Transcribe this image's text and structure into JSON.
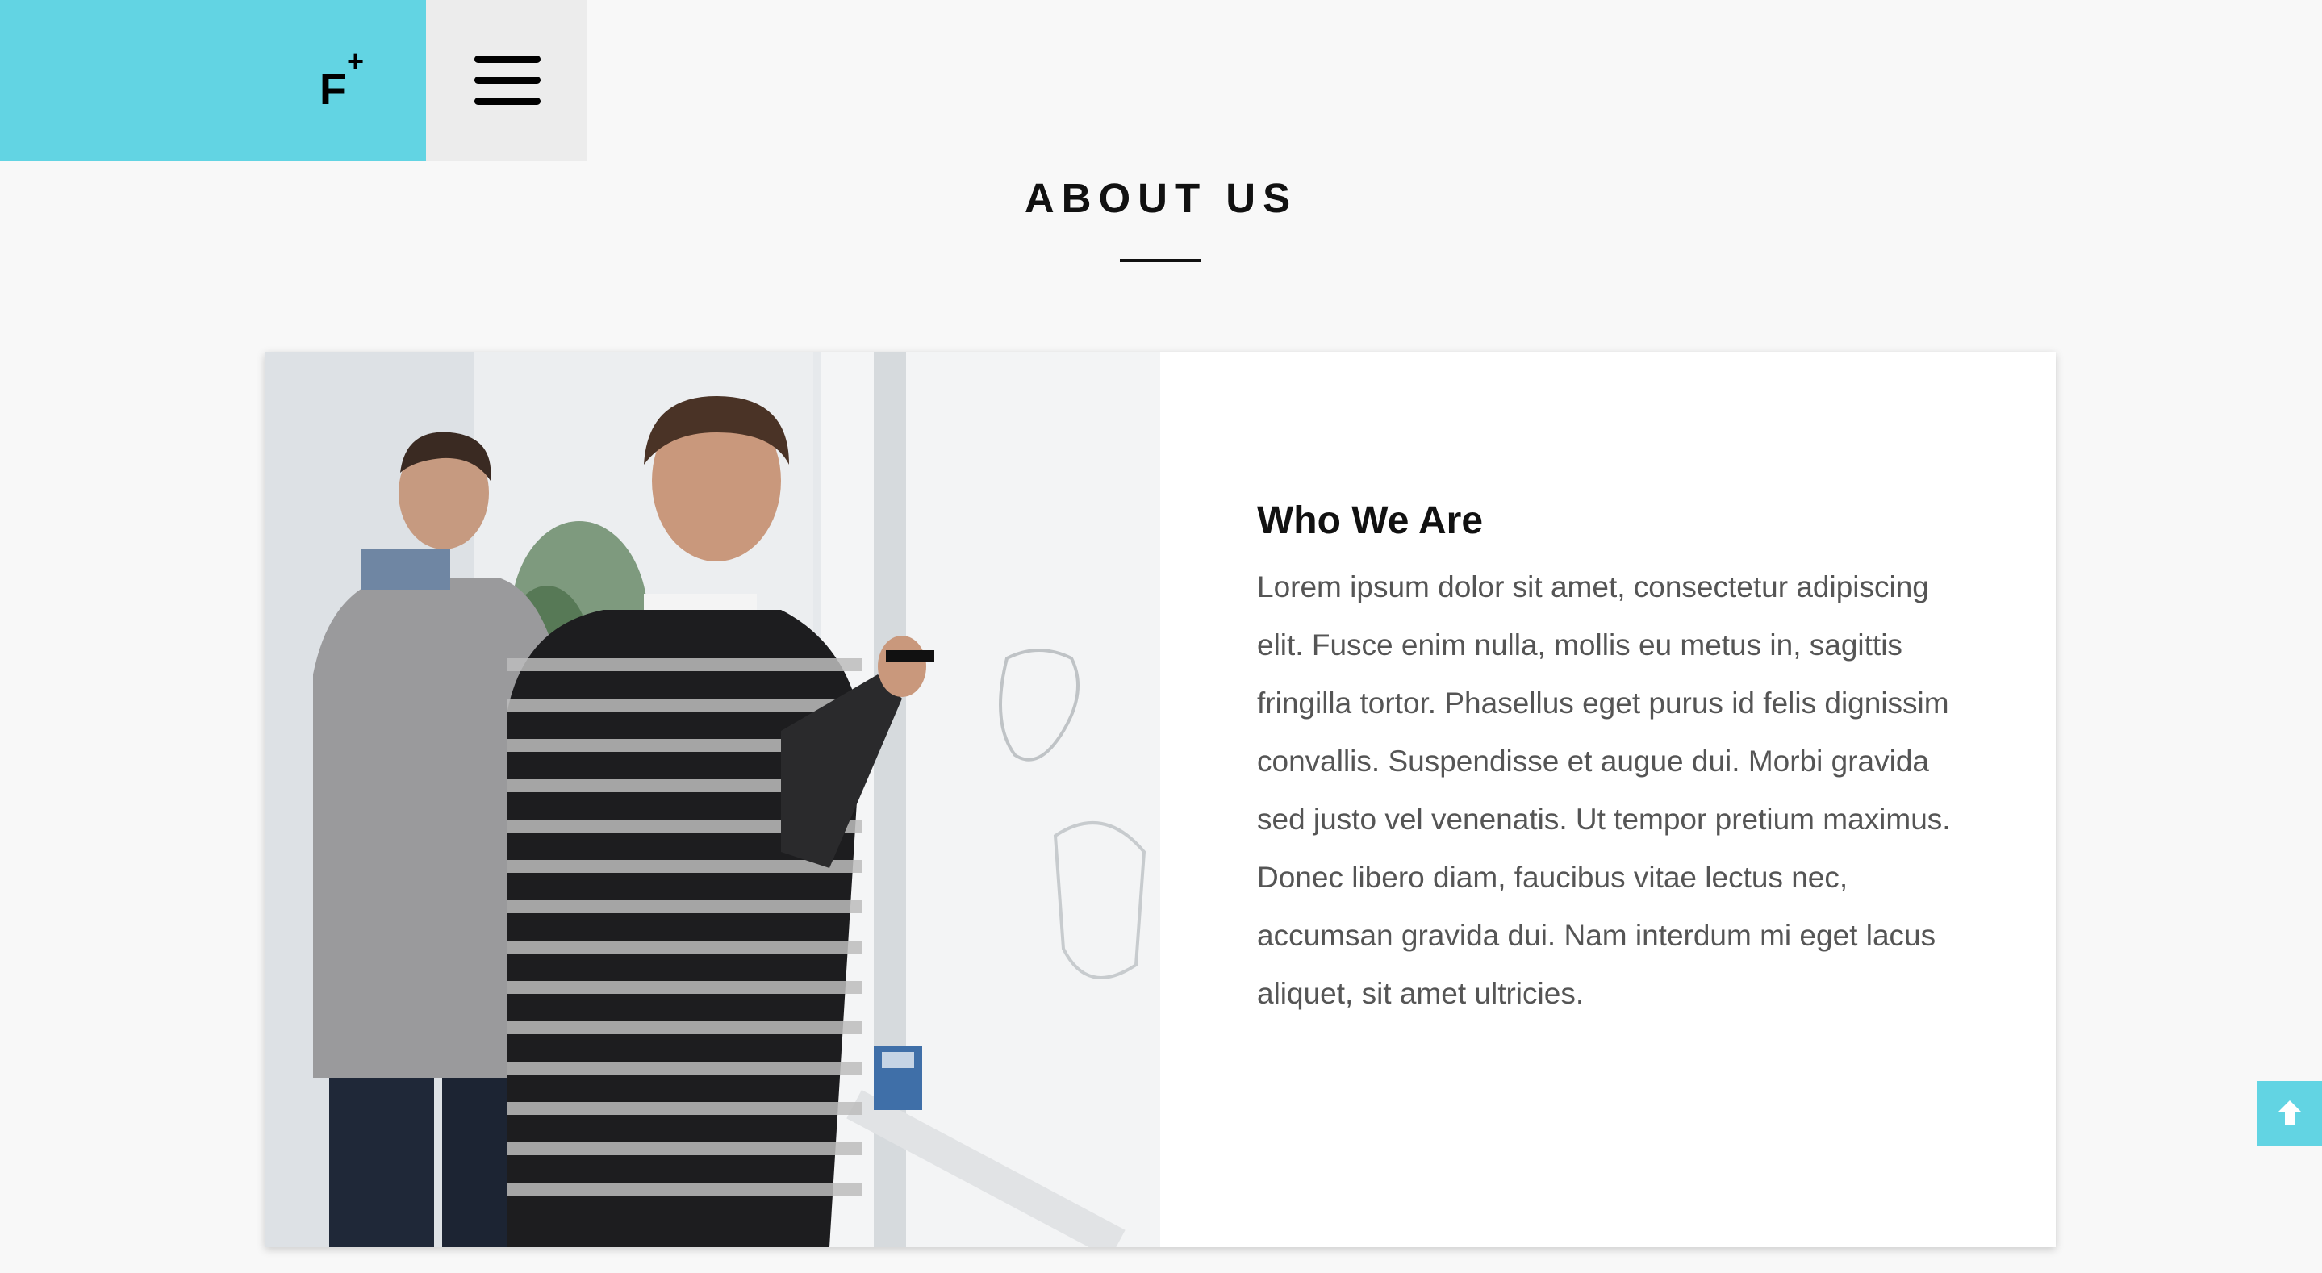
{
  "brand": {
    "logo_letter": "F",
    "logo_plus": "+",
    "color": "#62d4e3"
  },
  "header": {
    "menu_icon": "hamburger-menu-icon"
  },
  "section": {
    "title": "ABOUT US"
  },
  "about": {
    "image": "photo-two-men-at-whiteboard",
    "heading": "Who We Are",
    "body": "Lorem ipsum dolor sit amet, consectetur adipiscing elit. Fusce enim nulla, mollis eu metus in, sagittis fringilla tortor. Phasellus eget purus id felis dignissim convallis. Suspendisse et augue dui. Morbi gravida sed justo vel venenatis. Ut tempor pretium maximus. Donec libero diam, faucibus vitae lectus nec, accumsan gravida dui. Nam interdum mi eget lacus aliquet, sit amet ultricies."
  },
  "scroll_top": {
    "icon": "arrow-up-icon",
    "color": "#62d4e3"
  }
}
